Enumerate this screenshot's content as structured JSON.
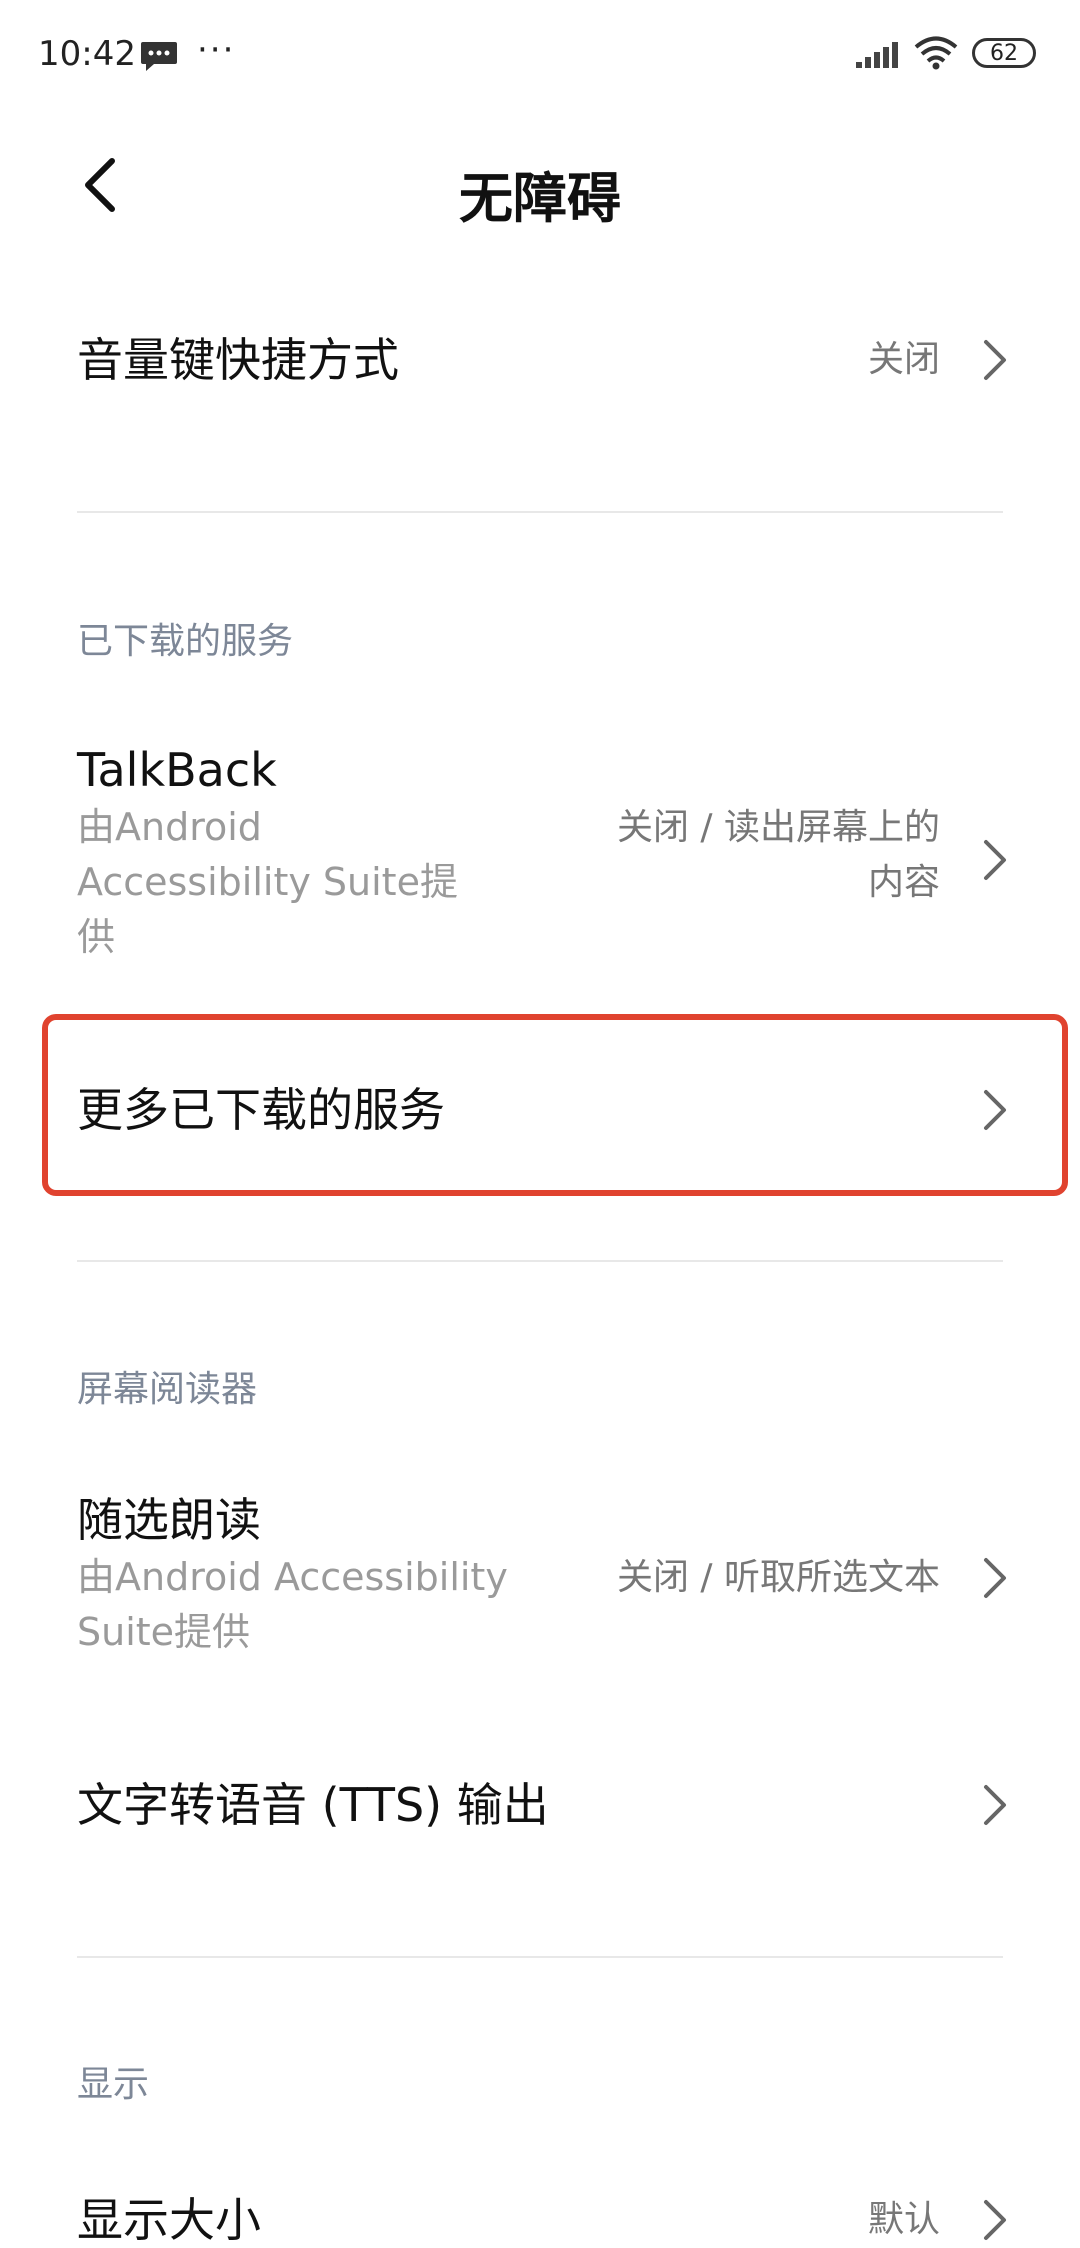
{
  "status_bar": {
    "time": "10:42",
    "icons": [
      "message-icon",
      "more-icon",
      "signal-icon",
      "wifi-icon",
      "battery-icon"
    ],
    "battery": "62"
  },
  "header": {
    "title": "无障碍"
  },
  "volume_shortcut": {
    "title": "音量键快捷方式",
    "value": "关闭"
  },
  "downloaded_section": {
    "header": "已下载的服务",
    "talkback": {
      "title": "TalkBack",
      "sub_lines": [
        "由Android",
        "Accessibility Suite提",
        "供"
      ],
      "value_lines": [
        "关闭 / 读出屏幕上的",
        "内容"
      ]
    },
    "more_services": {
      "title": "更多已下载的服务"
    }
  },
  "screen_reader_section": {
    "header": "屏幕阅读器",
    "select_to_speak": {
      "title": "随选朗读",
      "sub_lines": [
        "由Android Accessibility",
        "Suite提供"
      ],
      "value": "关闭 / 听取所选文本"
    },
    "tts": {
      "title": "文字转语音 (TTS) 输出"
    }
  },
  "display_section": {
    "header": "显示",
    "display_size": {
      "title": "显示大小",
      "value": "默认"
    }
  },
  "colors": {
    "highlight": "#e0432f",
    "section_header": "#7d8797",
    "subtitle": "#9a9a9a"
  }
}
